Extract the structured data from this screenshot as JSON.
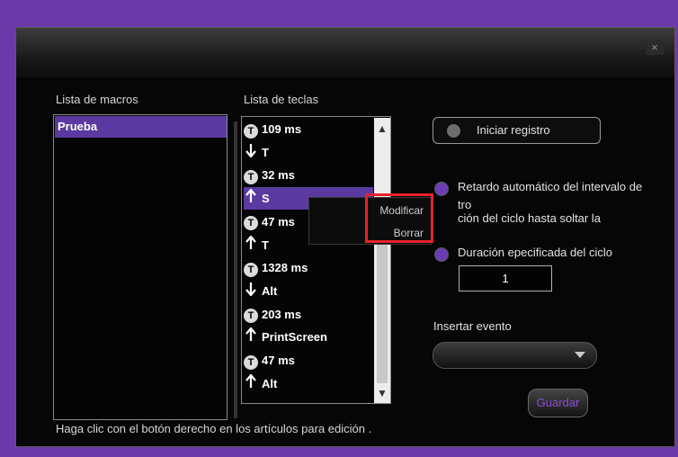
{
  "window": {
    "close_label": "×"
  },
  "macros": {
    "label": "Lista de macros",
    "items": [
      "Prueba"
    ]
  },
  "keys": {
    "label": "Lista de teclas",
    "items": [
      {
        "icon": "timer",
        "text": "109 ms"
      },
      {
        "icon": "down-arrow",
        "text": "T"
      },
      {
        "icon": "timer",
        "text": "32 ms"
      },
      {
        "icon": "up-arrow",
        "text": "S"
      },
      {
        "icon": "timer",
        "text": "47 ms"
      },
      {
        "icon": "up-arrow",
        "text": "T"
      },
      {
        "icon": "timer",
        "text": "1328 ms"
      },
      {
        "icon": "down-arrow",
        "text": "Alt"
      },
      {
        "icon": "timer",
        "text": "203 ms"
      },
      {
        "icon": "up-arrow",
        "text": "PrintScreen"
      },
      {
        "icon": "timer",
        "text": "47 ms"
      },
      {
        "icon": "up-arrow",
        "text": "Alt"
      }
    ],
    "selected_index": 3,
    "timer_glyph": "T",
    "scroll_up": "▲",
    "scroll_down": "▼"
  },
  "context_menu": {
    "items": [
      "Modificar",
      "Borrar"
    ]
  },
  "record_button": {
    "label": "Iniciar registro"
  },
  "options": {
    "auto_delay_line1": "Retardo automático del intervalo de",
    "auto_delay_line2": "tro",
    "cycle_release": "ción del ciclo hasta soltar la",
    "specified_cycles": "Duración epecificada del ciclo",
    "cycles_value": "1"
  },
  "insert_event": {
    "label": "Insertar evento",
    "value": ""
  },
  "save_button": {
    "label": "Guardar"
  },
  "footer": {
    "hint": "Haga clic con el botón derecho en los artículos para edición ."
  },
  "colors": {
    "accent": "#5a3aa0",
    "background": "#6a3aa8",
    "highlight": "#e8222a"
  }
}
